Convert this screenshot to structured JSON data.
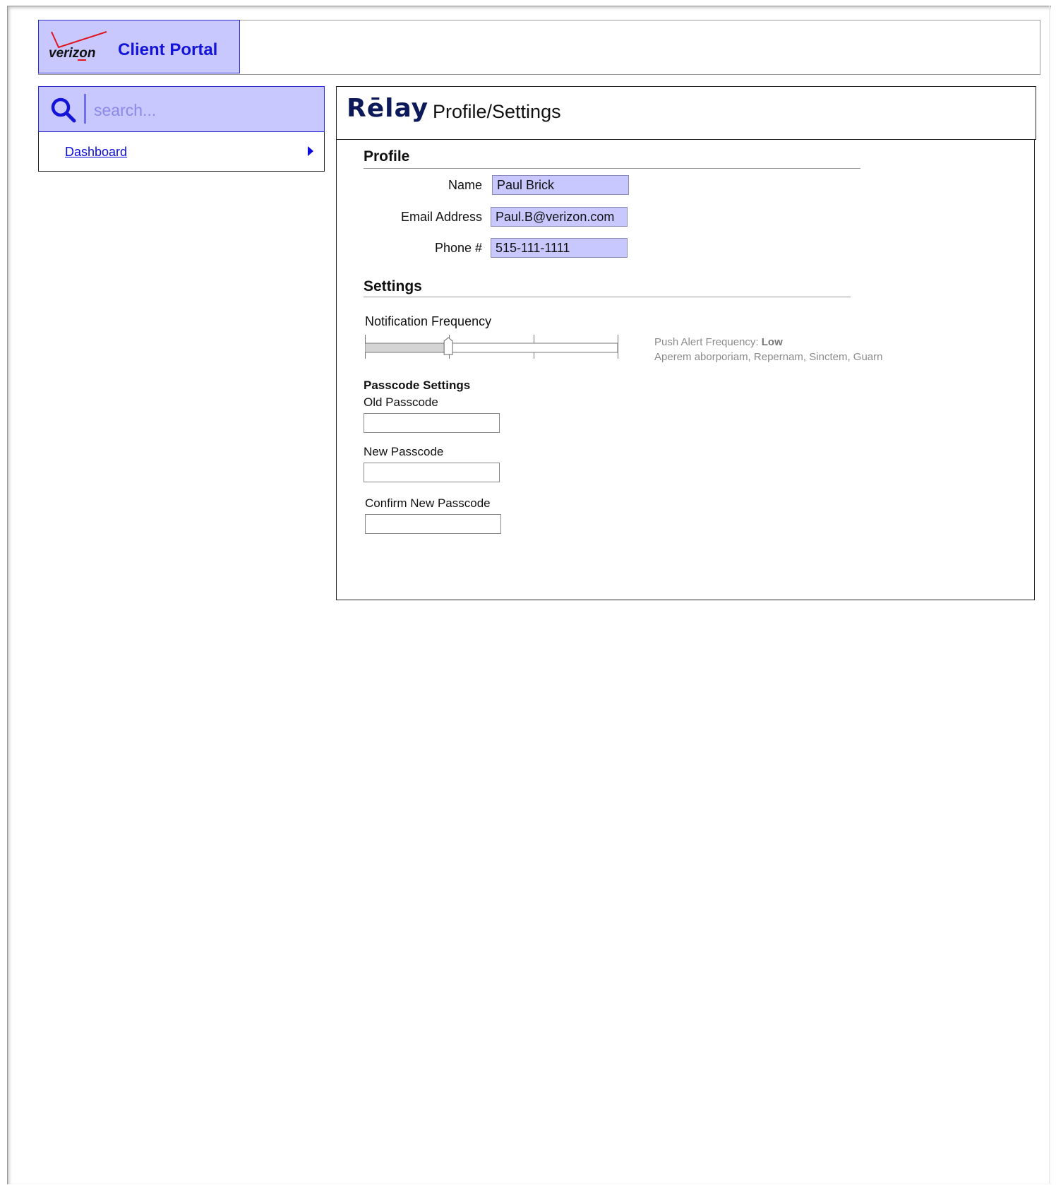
{
  "header": {
    "logo_name": "verizon",
    "title": "Client Portal"
  },
  "search": {
    "placeholder": "search..."
  },
  "sidebar": {
    "items": [
      {
        "label": "Dashboard"
      }
    ]
  },
  "main": {
    "logo_text": "Rēlay",
    "title": "Profile/Settings",
    "profile": {
      "section_title": "Profile",
      "fields": [
        {
          "label": "Name",
          "value": "Paul Brick"
        },
        {
          "label": "Email Address",
          "value": "Paul.B@verizon.com"
        },
        {
          "label": "Phone #",
          "value": "515-111-1111"
        }
      ]
    },
    "settings": {
      "section_title": "Settings",
      "notification": {
        "label": "Notification Frequency",
        "level_fraction": 0.33,
        "tick_count": 4,
        "hint_prefix": "Push Alert Frequency:",
        "hint_value": "Low",
        "hint_detail": "Aperem aborporiam, Repernam, Sinctem, Guarn"
      },
      "passcode": {
        "title": "Passcode Settings",
        "old_label": "Old Passcode",
        "new_label": "New Passcode",
        "confirm_label": "Confirm New Passcode"
      }
    }
  },
  "colors": {
    "accent_fill": "#c8c8ff",
    "accent_border": "#2b2bd6",
    "brand_text": "#1414d8",
    "link": "#0b0be0",
    "relay_navy": "#0d1a5a"
  }
}
